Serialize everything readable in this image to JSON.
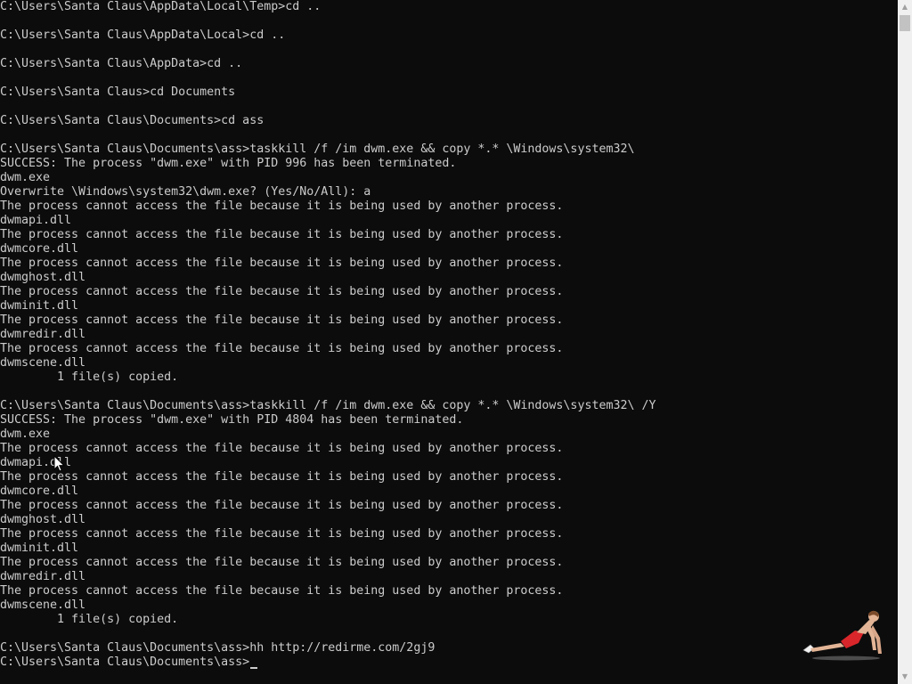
{
  "console": {
    "lines": [
      "C:\\Users\\Santa Claus\\AppData\\Local\\Temp>cd ..",
      "",
      "C:\\Users\\Santa Claus\\AppData\\Local>cd ..",
      "",
      "C:\\Users\\Santa Claus\\AppData>cd ..",
      "",
      "C:\\Users\\Santa Claus>cd Documents",
      "",
      "C:\\Users\\Santa Claus\\Documents>cd ass",
      "",
      "C:\\Users\\Santa Claus\\Documents\\ass>taskkill /f /im dwm.exe && copy *.* \\Windows\\system32\\",
      "SUCCESS: The process \"dwm.exe\" with PID 996 has been terminated.",
      "dwm.exe",
      "Overwrite \\Windows\\system32\\dwm.exe? (Yes/No/All): a",
      "The process cannot access the file because it is being used by another process.",
      "dwmapi.dll",
      "The process cannot access the file because it is being used by another process.",
      "dwmcore.dll",
      "The process cannot access the file because it is being used by another process.",
      "dwmghost.dll",
      "The process cannot access the file because it is being used by another process.",
      "dwminit.dll",
      "The process cannot access the file because it is being used by another process.",
      "dwmredir.dll",
      "The process cannot access the file because it is being used by another process.",
      "dwmscene.dll",
      "        1 file(s) copied.",
      "",
      "C:\\Users\\Santa Claus\\Documents\\ass>taskkill /f /im dwm.exe && copy *.* \\Windows\\system32\\ /Y",
      "SUCCESS: The process \"dwm.exe\" with PID 4804 has been terminated.",
      "dwm.exe",
      "The process cannot access the file because it is being used by another process.",
      "dwmapi.dll",
      "The process cannot access the file because it is being used by another process.",
      "dwmcore.dll",
      "The process cannot access the file because it is being used by another process.",
      "dwmghost.dll",
      "The process cannot access the file because it is being used by another process.",
      "dwminit.dll",
      "The process cannot access the file because it is being used by another process.",
      "dwmredir.dll",
      "The process cannot access the file because it is being used by another process.",
      "dwmscene.dll",
      "        1 file(s) copied.",
      "",
      "C:\\Users\\Santa Claus\\Documents\\ass>hh http://redirme.com/2gj9",
      ""
    ],
    "prompt": "C:\\Users\\Santa Claus\\Documents\\ass>"
  },
  "colors": {
    "background": "#0c0c0c",
    "text": "#cccccc",
    "scrollbar_track": "#f0f0f0",
    "scrollbar_thumb": "#c2c2c2"
  },
  "icons": {
    "scroll_up": "scroll-up-arrow-icon",
    "scroll_down": "scroll-down-arrow-icon",
    "pointer": "mouse-pointer-icon",
    "pet": "desktop-pet-figure"
  }
}
